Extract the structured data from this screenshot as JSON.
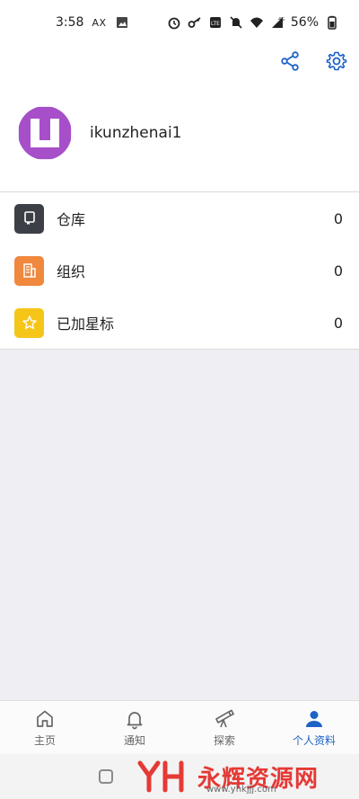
{
  "status_bar": {
    "time": "3:58",
    "carrier": "AX",
    "battery": "56%",
    "network": "4G"
  },
  "top_actions": {
    "share_icon": "share-icon",
    "settings_icon": "gear-icon"
  },
  "profile": {
    "username": "ikunzhenai1",
    "avatar_color": "#a64fc9"
  },
  "menu": {
    "items": [
      {
        "label": "仓库",
        "count": "0",
        "icon": "repository-icon",
        "color": "#3c3f46"
      },
      {
        "label": "组织",
        "count": "0",
        "icon": "organization-icon",
        "color": "#f0883e"
      },
      {
        "label": "已加星标",
        "count": "0",
        "icon": "star-icon",
        "color": "#f5c518"
      }
    ]
  },
  "bottom_nav": {
    "items": [
      {
        "label": "主页",
        "icon": "home-icon",
        "active": false
      },
      {
        "label": "通知",
        "icon": "bell-icon",
        "active": false
      },
      {
        "label": "探索",
        "icon": "telescope-icon",
        "active": false
      },
      {
        "label": "个人资料",
        "icon": "person-icon",
        "active": true
      }
    ],
    "active_color": "#1d62c7"
  },
  "watermark": {
    "text": "永辉资源网",
    "url": "www.yhkjjj.com"
  }
}
